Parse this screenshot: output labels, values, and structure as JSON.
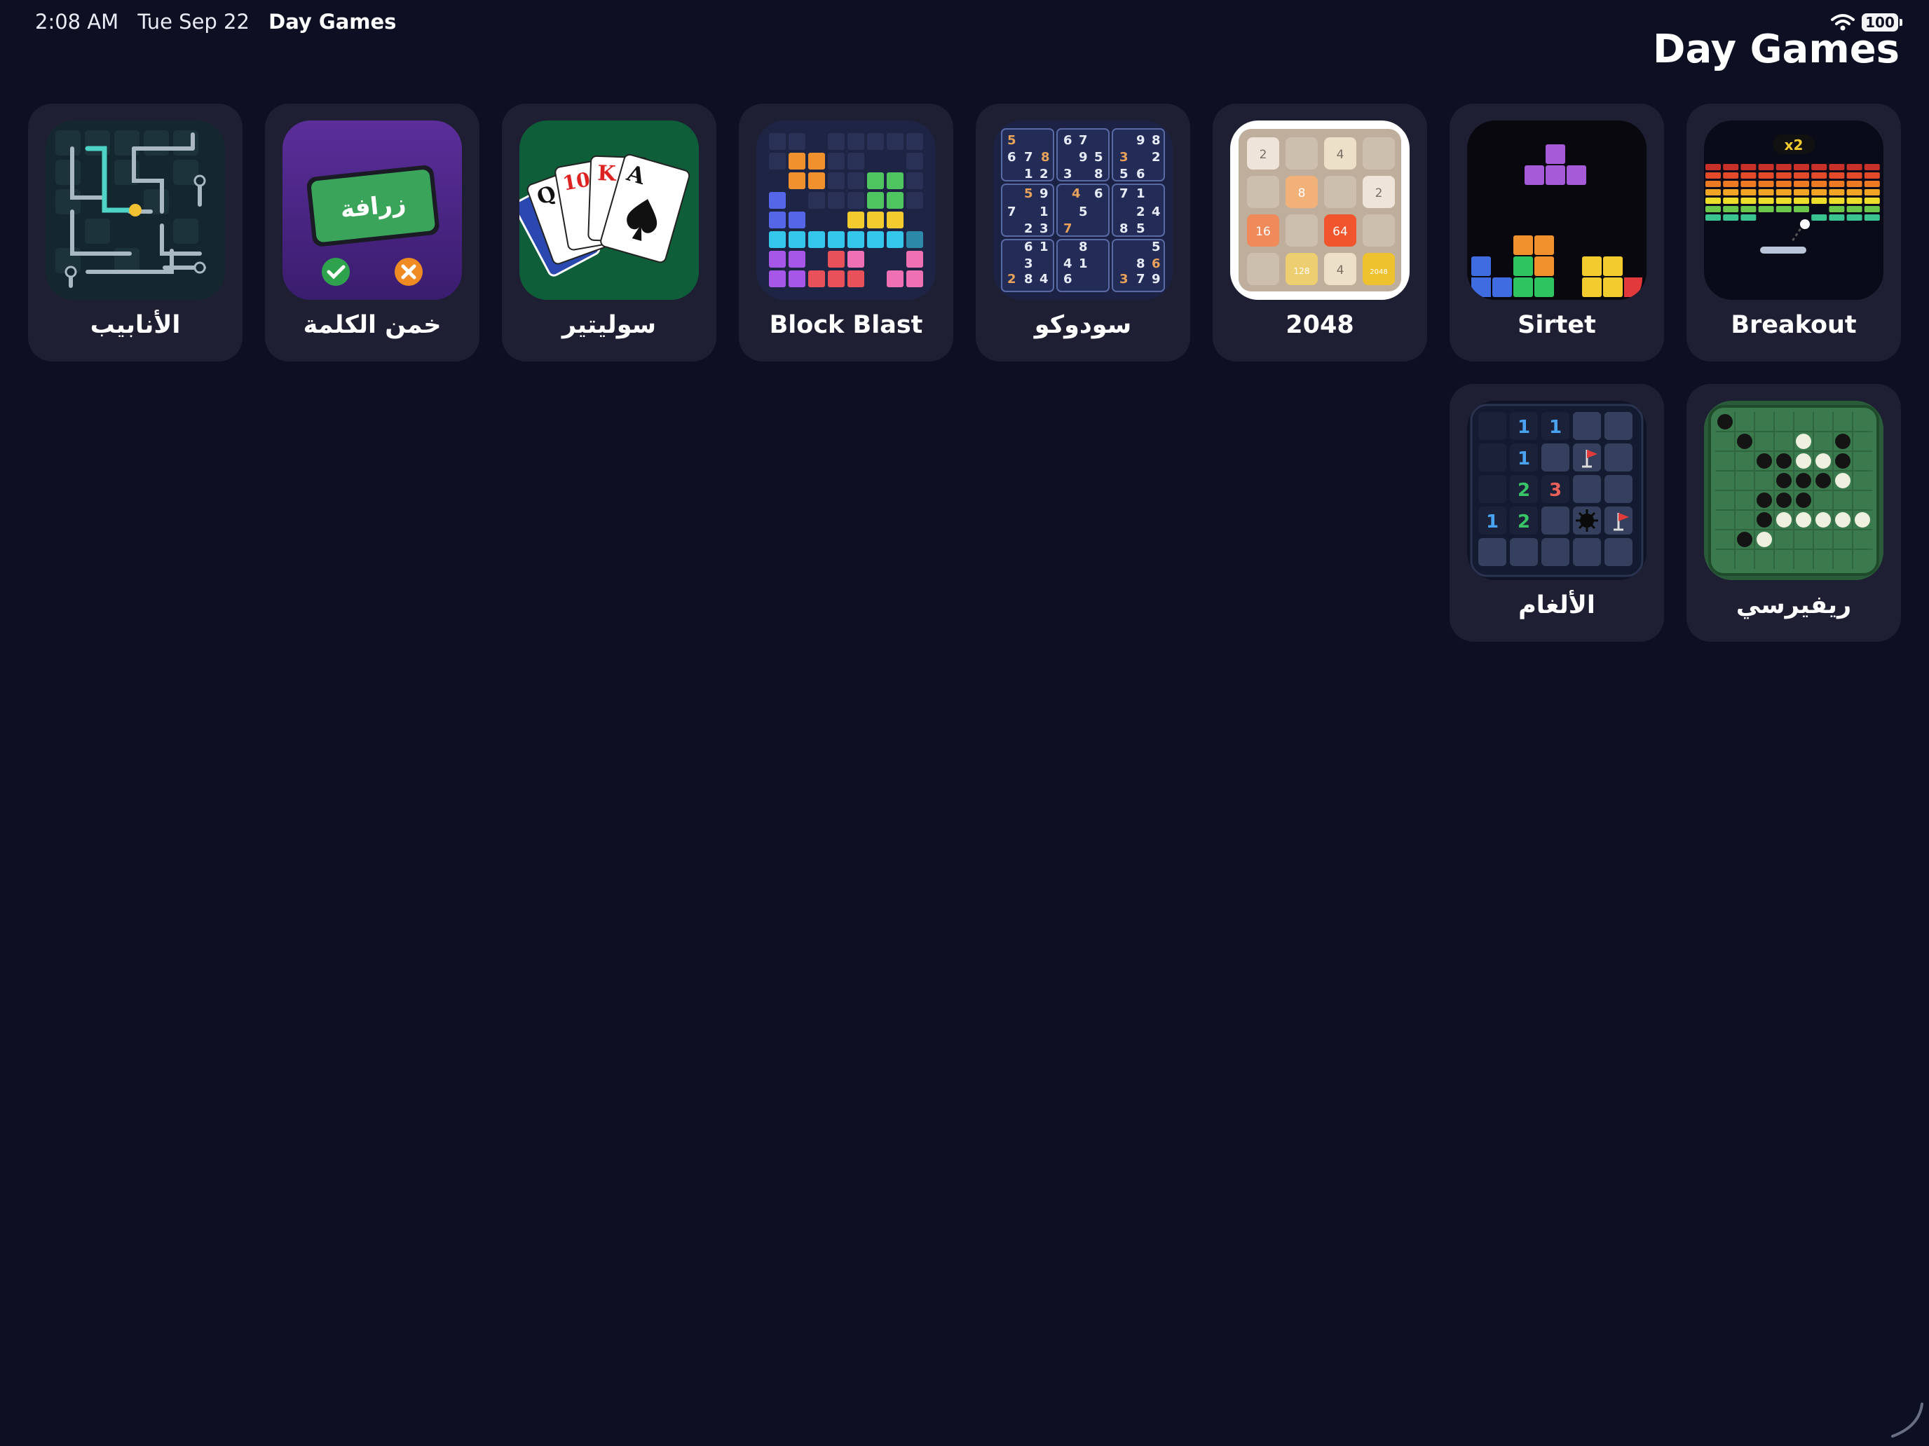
{
  "status_bar": {
    "time": "2:08 AM",
    "date": "Tue Sep 22",
    "app_name": "Day Games",
    "battery": "100",
    "wifi_icon": "wifi-icon"
  },
  "page": {
    "title": "Day Games"
  },
  "games": [
    {
      "label": "الأنابيب",
      "icon": "pipes-icon"
    },
    {
      "label": "خمن الكلمة",
      "icon": "guess-word-icon",
      "card_word": "زرافة"
    },
    {
      "label": "سوليتير",
      "icon": "solitaire-icon",
      "cards": [
        "Q",
        "10",
        "K",
        "A"
      ]
    },
    {
      "label": "Block Blast",
      "icon": "block-blast-icon"
    },
    {
      "label": "سودوكو",
      "icon": "sudoku-icon"
    },
    {
      "label": "2048",
      "icon": "2048-icon",
      "tiles": [
        "2",
        "",
        "4",
        "",
        "",
        "8",
        "",
        "2",
        "16",
        "",
        "64",
        "",
        "",
        "128",
        "4",
        "2048"
      ]
    },
    {
      "label": "Sirtet",
      "icon": "sirtet-icon"
    },
    {
      "label": "Breakout",
      "icon": "breakout-icon",
      "badge": "x2"
    },
    {
      "label": "الألغام",
      "icon": "minesweeper-icon",
      "numbers": [
        "1",
        "1",
        "1",
        "2",
        "3",
        "1",
        "2"
      ]
    },
    {
      "label": "ريفيرسي",
      "icon": "reversi-icon"
    }
  ],
  "colors": {
    "background": "#0d0f22",
    "card": "#1e1f33",
    "text": "#ffffff"
  }
}
